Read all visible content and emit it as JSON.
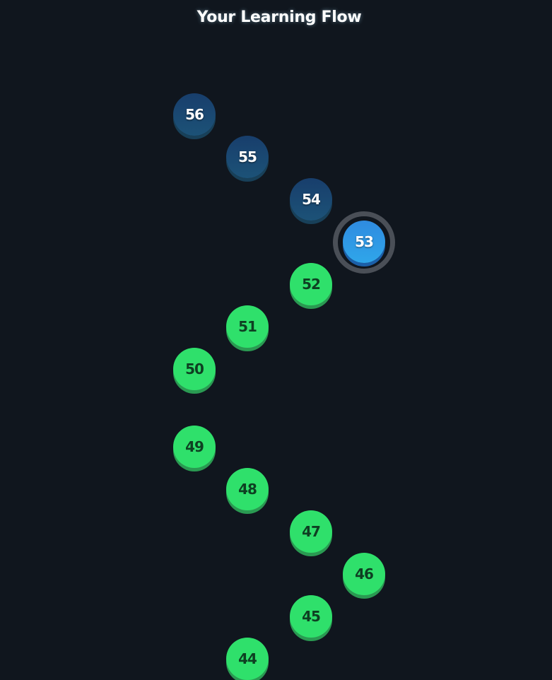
{
  "page": {
    "title": "Your Learning Flow"
  },
  "colors": {
    "background": "#10161e",
    "completed": "#2fe06b",
    "completed_text": "#0e3f22",
    "locked": "#1c4a72",
    "current": "#2f9ae6",
    "current_ring": "#4a4f57"
  },
  "lessons": [
    {
      "number": "56",
      "status": "locked"
    },
    {
      "number": "55",
      "status": "locked"
    },
    {
      "number": "54",
      "status": "locked"
    },
    {
      "number": "53",
      "status": "current"
    },
    {
      "number": "52",
      "status": "completed"
    },
    {
      "number": "51",
      "status": "completed"
    },
    {
      "number": "50",
      "status": "completed"
    },
    {
      "number": "49",
      "status": "completed"
    },
    {
      "number": "48",
      "status": "completed"
    },
    {
      "number": "47",
      "status": "completed"
    },
    {
      "number": "46",
      "status": "completed"
    },
    {
      "number": "45",
      "status": "completed"
    },
    {
      "number": "44",
      "status": "completed"
    }
  ]
}
